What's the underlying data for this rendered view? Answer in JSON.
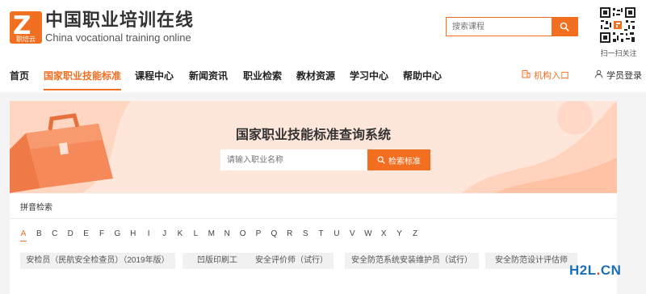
{
  "logo": {
    "badge_letter": "Z",
    "badge_caption": "职培云",
    "title_cn": "中国职业培训在线",
    "title_en": "China vocational training online"
  },
  "header_search": {
    "placeholder": "搜索课程",
    "button_icon": "search-icon"
  },
  "qr": {
    "caption": "扫一扫关注"
  },
  "nav": {
    "items": [
      {
        "label": "首页"
      },
      {
        "label": "国家职业技能标准",
        "active": true
      },
      {
        "label": "课程中心"
      },
      {
        "label": "新闻资讯"
      },
      {
        "label": "职业检索"
      },
      {
        "label": "教材资源"
      },
      {
        "label": "学习中心"
      },
      {
        "label": "帮助中心"
      }
    ],
    "org_entry": "机构入口",
    "org_icon": "building-icon",
    "student_login": "学员登录",
    "student_icon": "user-icon"
  },
  "banner": {
    "title": "国家职业技能标准查询系统",
    "search_placeholder": "请输入职业名称",
    "search_button": "检索标准",
    "search_icon": "search-icon"
  },
  "index": {
    "label": "拼音检索",
    "letters": [
      "A",
      "B",
      "C",
      "D",
      "E",
      "F",
      "G",
      "H",
      "I",
      "J",
      "K",
      "L",
      "M",
      "N",
      "O",
      "P",
      "Q",
      "R",
      "S",
      "T",
      "U",
      "V",
      "W",
      "X",
      "Y",
      "Z"
    ],
    "active_letter": "A",
    "tags": [
      "安检员（民航安全检查员）（2019年版）",
      "凹版印刷工",
      "安全评价师（试行）",
      "安全防范系统安装维护员（试行）",
      "安全防范设计评估师"
    ]
  },
  "watermark": {
    "h2l": "H2L",
    "dot": ".",
    "cn": "CN"
  },
  "colors": {
    "accent": "#f26f21",
    "banner_bg": "#ffe6da",
    "watermark_blue": "#1b6fb8",
    "watermark_red": "#e8382f"
  }
}
